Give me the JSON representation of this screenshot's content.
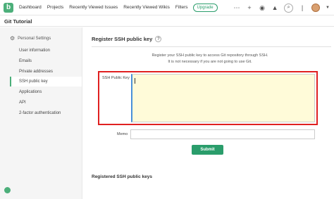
{
  "nav": {
    "logo_letter": "b",
    "items": [
      "Dashboard",
      "Projects",
      "Recently Viewed Issues",
      "Recently Viewed Wikis",
      "Filters"
    ],
    "upgrade": "Upgrade",
    "icons": [
      "more-icon",
      "plus-icon",
      "watch-icon",
      "bell-icon",
      "search-icon",
      "avatar",
      "chevron-down-icon"
    ]
  },
  "page": {
    "title": "Git Tutorial"
  },
  "sidebar": {
    "heading": "Personal Settings",
    "items": [
      {
        "label": "User information",
        "active": false
      },
      {
        "label": "Emails",
        "active": false
      },
      {
        "label": "Private addresses",
        "active": false
      },
      {
        "label": "SSH public key",
        "active": true
      },
      {
        "label": "Applications",
        "active": false
      },
      {
        "label": "API",
        "active": false
      },
      {
        "label": "2-factor authentication",
        "active": false
      }
    ]
  },
  "main": {
    "title": "Register SSH public key",
    "help": "?",
    "desc_line1": "Register your SSH public key to access Git repository through SSH.",
    "desc_line2": "It is not necessary if you are not going to use Git.",
    "key_label": "SSH Public Key",
    "key_value": "",
    "memo_label": "Memo",
    "memo_value": "",
    "submit": "Submit",
    "registered_title": "Registered SSH public keys"
  },
  "colors": {
    "accent": "#2a9d6b",
    "highlight": "#e02020",
    "textarea_bg": "#fffbd9"
  }
}
